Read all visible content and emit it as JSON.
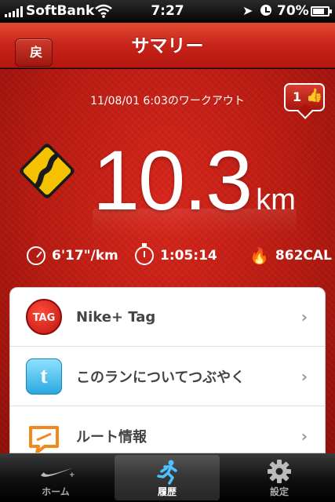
{
  "status_bar": {
    "carrier": "SoftBank",
    "time": "7:27",
    "battery_percent": "70%"
  },
  "nav": {
    "back_label": "戻る",
    "title": "サマリー"
  },
  "summary": {
    "workout_date": "11/08/01 6:03のワークアウト",
    "like_count": "1",
    "distance_value": "10.3",
    "distance_unit": "km",
    "pace": "6'17\"/km",
    "duration": "1:05:14",
    "calories": "862CAL"
  },
  "list": {
    "items": [
      {
        "label": "Nike+ Tag",
        "icon": "nike-tag-icon"
      },
      {
        "label": "このランについてつぶやく",
        "icon": "twitter-icon"
      },
      {
        "label": "ルート情報",
        "icon": "route-map-icon"
      }
    ],
    "tag_icon_text": "TAG"
  },
  "tabbar": {
    "tabs": [
      {
        "label": "ホーム",
        "icon": "nike-swoosh-icon",
        "active": false
      },
      {
        "label": "履歴",
        "icon": "runner-icon",
        "active": true
      },
      {
        "label": "設定",
        "icon": "gear-icon",
        "active": false
      }
    ]
  },
  "colors": {
    "primary_red": "#c8231a",
    "road_sign_yellow": "#f4c200"
  }
}
